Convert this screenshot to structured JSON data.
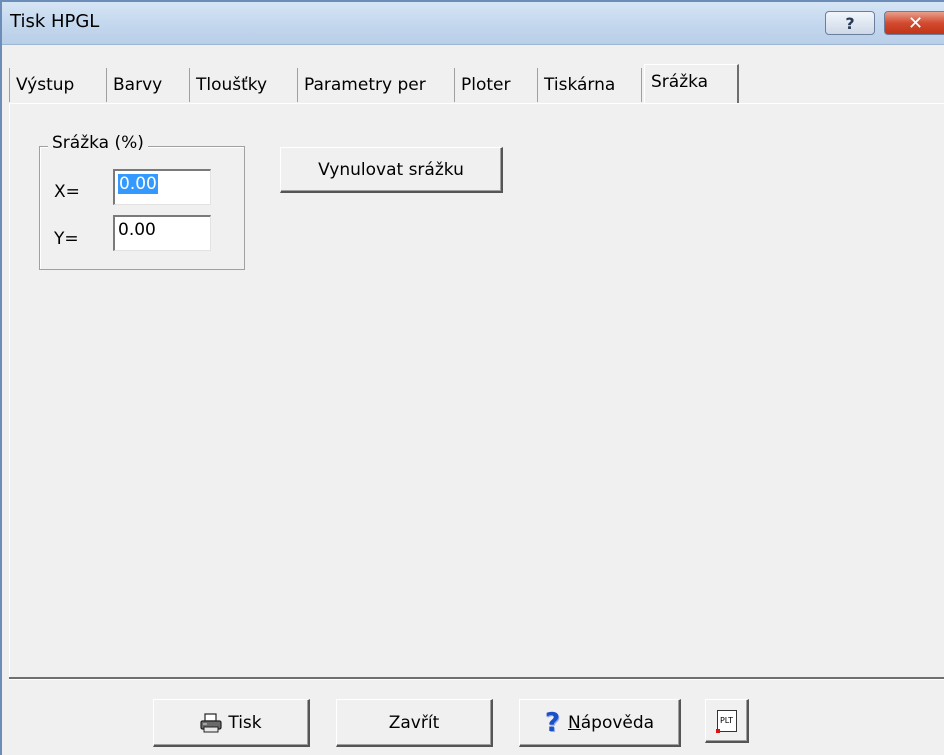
{
  "window": {
    "title": "Tisk HPGL"
  },
  "titlebar": {
    "help_glyph": "?",
    "close_glyph": "✕"
  },
  "tabs": [
    {
      "label": "Výstup"
    },
    {
      "label": "Barvy"
    },
    {
      "label": "Tloušťky"
    },
    {
      "label": "Parametry per"
    },
    {
      "label": "Ploter"
    },
    {
      "label": "Tiskárna"
    },
    {
      "label": "Srážka",
      "active": true
    }
  ],
  "shrink": {
    "group_label": "Srážka (%)",
    "x_label": "X=",
    "x_value": "0.00",
    "y_label": "Y=",
    "y_value": "0.00",
    "reset_button": "Vynulovat srážku"
  },
  "buttons": {
    "print": "Tisk",
    "close": "Zavřít",
    "help_mnemonic": "N",
    "help_rest": "ápověda",
    "plt_icon_text": "PLT"
  },
  "colors": {
    "titlebar": "#c4d8ee",
    "close_button": "#d24a2f",
    "selection": "#3399ff",
    "face": "#f0f0f0"
  },
  "icons": {
    "print": "printer-icon",
    "help": "question-mark-icon",
    "plt": "plt-file-icon"
  }
}
